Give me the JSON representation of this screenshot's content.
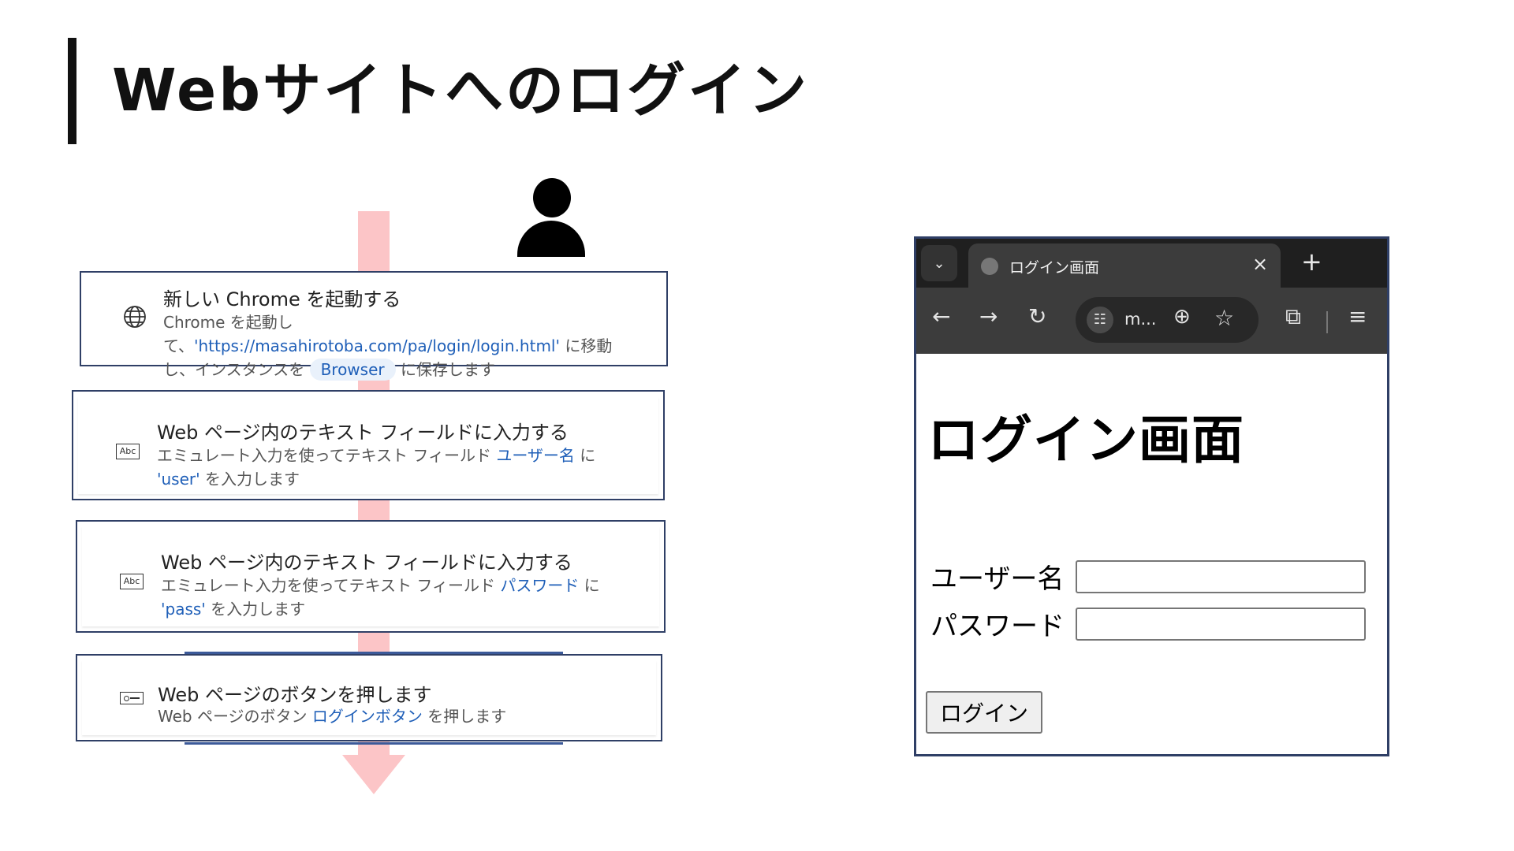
{
  "slide": {
    "title": "Webサイトへのログイン"
  },
  "steps": [
    {
      "title": "新しい Chrome を起動する",
      "desc_1": "Chrome を起動して、",
      "desc_link": "'https://masahirotoba.com/pa/login/login.html'",
      "desc_2": " に移動し、インスタンスを ",
      "chip": "Browser",
      "desc_3": " に保存します",
      "icon": "globe-icon"
    },
    {
      "title": "Web ページ内のテキスト フィールドに入力する",
      "desc_1": "エミュレート入力を使ってテキスト フィールド ",
      "field": "ユーザー名",
      "desc_2": " に ",
      "value": "'user'",
      "desc_3": " を入力します",
      "icon": "Abc"
    },
    {
      "title": "Web ページ内のテキスト フィールドに入力する",
      "desc_1": "エミュレート入力を使ってテキスト フィールド ",
      "field": "パスワード",
      "desc_2": " に ",
      "value": "'pass'",
      "desc_3": " を入力します",
      "icon": "Abc"
    },
    {
      "title": "Web ページのボタンを押します",
      "desc_1": "Web ページのボタン ",
      "field": "ログインボタン",
      "desc_2": " を押します",
      "icon": "button-icon"
    }
  ],
  "browser": {
    "tab_title": "ログイン画面",
    "url": "m...",
    "new_tab": "+",
    "close": "×",
    "icons": [
      "back-arrow-icon",
      "forward-arrow-icon",
      "reload-icon",
      "zoom-icon",
      "star-icon",
      "extensions-icon",
      "media-icon"
    ]
  },
  "login_page": {
    "heading": "ログイン画面",
    "username_label": "ユーザー名",
    "password_label": "パスワード",
    "username_value": "",
    "password_value": "",
    "button_label": "ログイン"
  },
  "colors": {
    "flow": "#fcc5c7",
    "card_border": "#2f3f66",
    "link": "#1f5fb8",
    "browser_dark": "#1f1f1f",
    "browser_toolbar": "#3c3c3c"
  }
}
